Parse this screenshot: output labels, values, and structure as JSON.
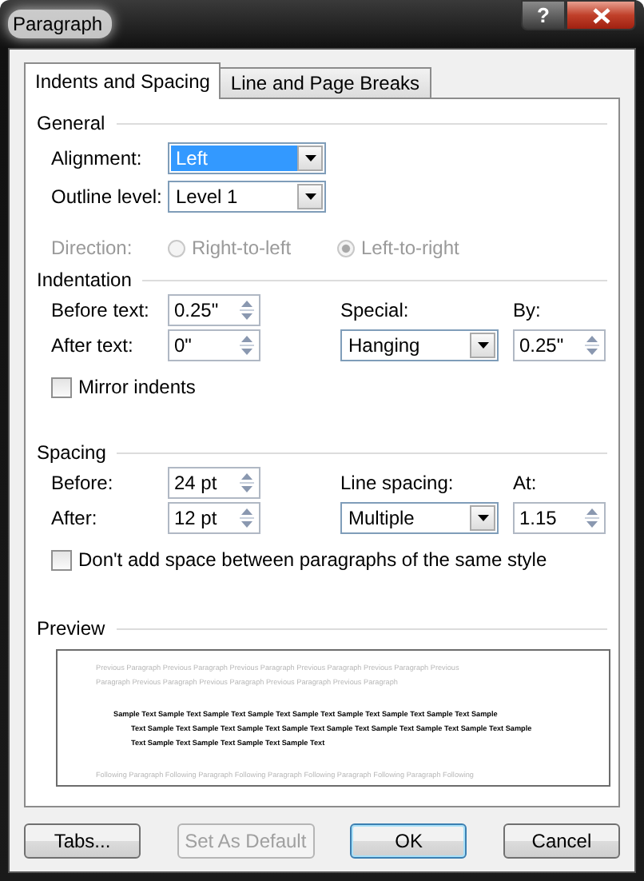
{
  "window": {
    "title": "Paragraph",
    "help_button": "?"
  },
  "tabs": [
    {
      "label": "Indents and Spacing",
      "selected": true
    },
    {
      "label": "Line and Page Breaks",
      "selected": false
    }
  ],
  "general": {
    "heading": "General",
    "alignment": {
      "label": "Alignment:",
      "value": "Left",
      "selected": true
    },
    "outline_level": {
      "label": "Outline level:",
      "value": "Level 1",
      "selected": false
    },
    "direction": {
      "label": "Direction:",
      "disabled": true,
      "options": [
        {
          "label": "Right-to-left",
          "selected": false
        },
        {
          "label": "Left-to-right",
          "selected": true
        }
      ]
    }
  },
  "indentation": {
    "heading": "Indentation",
    "before_text": {
      "label": "Before text:",
      "value": "0.25\""
    },
    "after_text": {
      "label": "After text:",
      "value": "0\""
    },
    "special": {
      "label": "Special:",
      "value": "Hanging"
    },
    "by": {
      "label": "By:",
      "value": "0.25\""
    },
    "mirror_indents": {
      "label": "Mirror indents",
      "checked": false
    }
  },
  "spacing": {
    "heading": "Spacing",
    "before": {
      "label": "Before:",
      "value": "24 pt"
    },
    "after": {
      "label": "After:",
      "value": "12 pt"
    },
    "line_spacing": {
      "label": "Line spacing:",
      "value": "Multiple"
    },
    "at": {
      "label": "At:",
      "value": "1.15"
    },
    "no_space_same_style": {
      "label": "Don't add space between paragraphs of the same style",
      "checked": false
    }
  },
  "preview": {
    "heading": "Preview",
    "previous_lines": [
      "Previous Paragraph Previous Paragraph Previous Paragraph Previous Paragraph Previous Paragraph Previous",
      "Paragraph Previous Paragraph Previous Paragraph Previous Paragraph Previous Paragraph"
    ],
    "sample_lines": [
      "Sample Text Sample Text Sample Text Sample Text Sample Text Sample Text Sample Text Sample Text Sample",
      "Text Sample Text Sample Text Sample Text Sample Text Sample Text Sample Text Sample Text Sample Text Sample",
      "Text Sample Text Sample Text Sample Text Sample Text"
    ],
    "following_lines": [
      "Following Paragraph Following Paragraph Following Paragraph Following Paragraph Following Paragraph Following"
    ]
  },
  "buttons": [
    {
      "label": "Tabs...",
      "disabled": false,
      "default": false
    },
    {
      "label": "Set As Default",
      "disabled": true,
      "default": false
    },
    {
      "label": "OK",
      "disabled": false,
      "default": true
    },
    {
      "label": "Cancel",
      "disabled": false,
      "default": false
    }
  ]
}
